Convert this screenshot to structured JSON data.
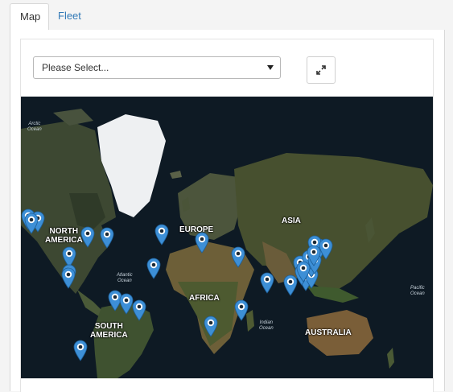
{
  "tabs": [
    {
      "label": "Map",
      "active": true
    },
    {
      "label": "Fleet",
      "active": false
    }
  ],
  "selector": {
    "value": "Please Select..."
  },
  "expand_button": {
    "icon": "expand-arrows-icon"
  },
  "map": {
    "continent_labels": {
      "north_america": "NORTH\nAMERICA",
      "south_america": "SOUTH\nAMERICA",
      "europe": "EUROPE",
      "asia": "ASIA",
      "africa": "AFRICA",
      "australia": "AUSTRALIA"
    },
    "ocean_labels": {
      "arctic": "Arctic\nOcean",
      "atlantic": "Atlantic\nOcean",
      "indian": "Indian\nOcean",
      "pacific": "Pacific\nOcean"
    },
    "marker_color": "#3d8fd6",
    "marker_count": 32
  },
  "colors": {
    "tab_link": "#337ab7",
    "map_background": "#0e1a24",
    "land": "#3f4a34",
    "ice": "#f2f2f2"
  }
}
